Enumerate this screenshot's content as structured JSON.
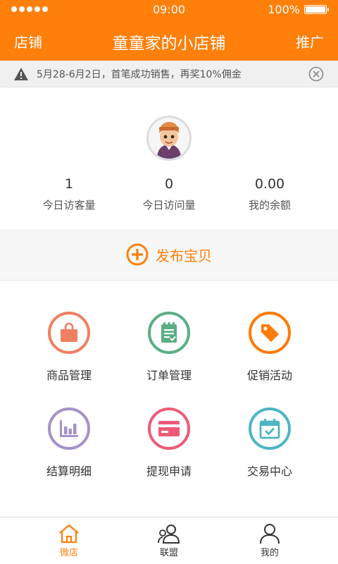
{
  "status_bar": {
    "time": "09:00",
    "battery": "100%"
  },
  "nav": {
    "left": "店铺",
    "title": "童童家的小店铺",
    "right": "推广"
  },
  "notice": {
    "text": "5月28-6月2日，首笔成功销售，再奖10%佣金"
  },
  "stats": [
    {
      "value": "1",
      "label": "今日访客量"
    },
    {
      "value": "0",
      "label": "今日访问量"
    },
    {
      "value": "0.00",
      "label": "我的余额"
    }
  ],
  "publish": {
    "label": "发布宝贝"
  },
  "menu": [
    {
      "label": "商品管理",
      "icon": "shopping-bag-icon",
      "color": "#ef7f61"
    },
    {
      "label": "订单管理",
      "icon": "order-clipboard-icon",
      "color": "#5aae82"
    },
    {
      "label": "促销活动",
      "icon": "price-tag-icon",
      "color": "#fd7b06"
    },
    {
      "label": "结算明细",
      "icon": "bar-chart-icon",
      "color": "#a592c7"
    },
    {
      "label": "提现申请",
      "icon": "credit-card-icon",
      "color": "#ed5a78"
    },
    {
      "label": "交易中心",
      "icon": "calendar-check-icon",
      "color": "#4cb5c4"
    }
  ],
  "tabs": [
    {
      "label": "微店",
      "icon": "house-icon",
      "active": true
    },
    {
      "label": "联盟",
      "icon": "users-icon",
      "active": false
    },
    {
      "label": "我的",
      "icon": "person-icon",
      "active": false
    }
  ],
  "colors": {
    "brand": "#fe7f0a",
    "tab_inactive": "#333333"
  }
}
